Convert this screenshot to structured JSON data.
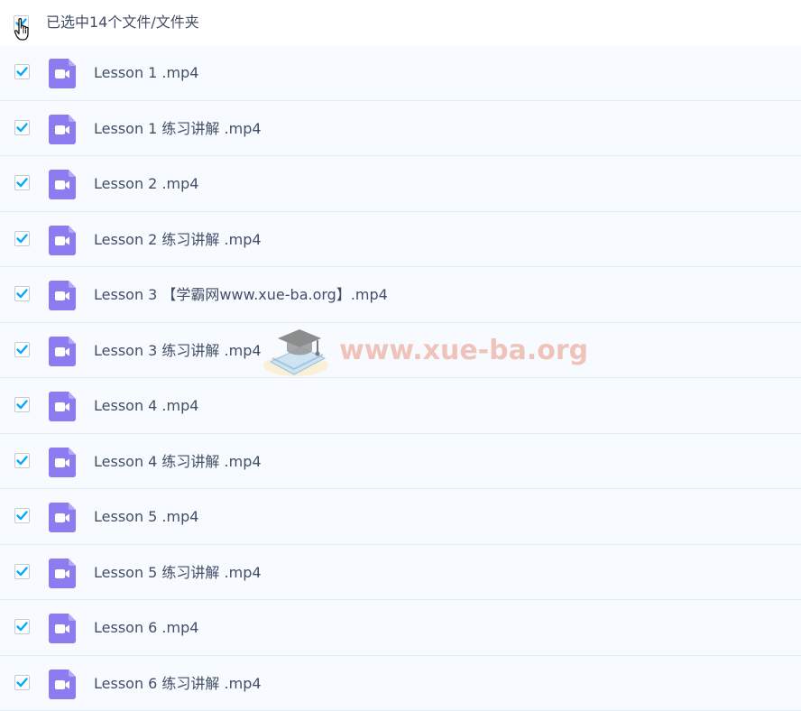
{
  "header": {
    "select_all_checked": true,
    "selection_text": "已选中14个文件/文件夹"
  },
  "files": [
    {
      "name": "Lesson 1 .mp4",
      "checked": true
    },
    {
      "name": "Lesson 1 练习讲解 .mp4",
      "checked": true
    },
    {
      "name": "Lesson 2 .mp4",
      "checked": true
    },
    {
      "name": "Lesson 2 练习讲解 .mp4",
      "checked": true
    },
    {
      "name": "Lesson 3 【学霸网www.xue-ba.org】.mp4",
      "checked": true
    },
    {
      "name": "Lesson 3 练习讲解 .mp4",
      "checked": true
    },
    {
      "name": "Lesson 4 .mp4",
      "checked": true
    },
    {
      "name": "Lesson 4 练习讲解 .mp4",
      "checked": true
    },
    {
      "name": "Lesson 5 .mp4",
      "checked": true
    },
    {
      "name": "Lesson 5 练习讲解 .mp4",
      "checked": true
    },
    {
      "name": "Lesson 6 .mp4",
      "checked": true
    },
    {
      "name": "Lesson 6 练习讲解 .mp4",
      "checked": true
    }
  ],
  "icons": {
    "checkbox": "checkbox-checked-icon",
    "file": "video-file-icon",
    "cursor": "hand-pointer-icon",
    "watermark_logo": "graduation-cap-book-icon"
  },
  "watermark": {
    "text": "www.xue-ba.org"
  },
  "colors": {
    "check": "#06a7ff",
    "video_icon": "#8b7cf0",
    "row_bg": "#f7fbff",
    "row_border": "#e1ecf5",
    "text": "#424e67"
  }
}
